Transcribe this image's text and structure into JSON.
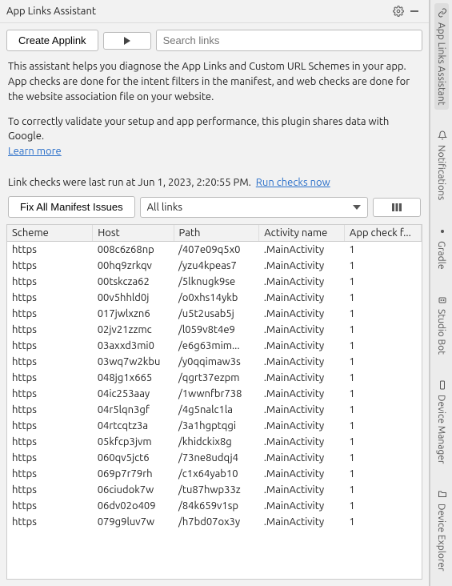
{
  "header": {
    "title": "App Links Assistant"
  },
  "toolbar": {
    "create_label": "Create Applink",
    "search_placeholder": "Search links"
  },
  "description": {
    "p1": "This assistant helps you diagnose the App Links and Custom URL Schemes in your app. App checks are done for the intent filters in the manifest, and web checks are done for the website association file on your website.",
    "p2": "To correctly validate your setup and app performance, this plugin shares data with Google.",
    "learn_more": "Learn more"
  },
  "status": {
    "prefix": "Link checks were last run at Jun 1, 2023, 2:20:55 PM.",
    "run_now": "Run checks now"
  },
  "controls": {
    "fix_label": "Fix All Manifest Issues",
    "filter_label": "All links"
  },
  "columns": {
    "scheme": "Scheme",
    "host": "Host",
    "path": "Path",
    "activity": "Activity name",
    "check": "App check f..."
  },
  "rows": [
    {
      "scheme": "https",
      "host": "008c6z68np",
      "path": "/407e09q5x0",
      "activity": ".MainActivity",
      "check": "1"
    },
    {
      "scheme": "https",
      "host": "00hq9zrkqv",
      "path": "/yzu4kpeas7",
      "activity": ".MainActivity",
      "check": "1"
    },
    {
      "scheme": "https",
      "host": "00tskcza62",
      "path": "/5lknugk9se",
      "activity": ".MainActivity",
      "check": "1"
    },
    {
      "scheme": "https",
      "host": "00v5hhld0j",
      "path": "/o0xhs14ykb",
      "activity": ".MainActivity",
      "check": "1"
    },
    {
      "scheme": "https",
      "host": "017jwlxzn6",
      "path": "/u5t2usab5j",
      "activity": ".MainActivity",
      "check": "1"
    },
    {
      "scheme": "https",
      "host": "02jv21zzmc",
      "path": "/l059v8t4e9",
      "activity": ".MainActivity",
      "check": "1"
    },
    {
      "scheme": "https",
      "host": "03axxd3mi0",
      "path": "/e6g63mim...",
      "activity": ".MainActivity",
      "check": "1"
    },
    {
      "scheme": "https",
      "host": "03wq7w2kbu",
      "path": "/y0qqimaw3s",
      "activity": ".MainActivity",
      "check": "1"
    },
    {
      "scheme": "https",
      "host": "048jg1x665",
      "path": "/qgrt37ezpm",
      "activity": ".MainActivity",
      "check": "1"
    },
    {
      "scheme": "https",
      "host": "04ic253aay",
      "path": "/1wwnfbr738",
      "activity": ".MainActivity",
      "check": "1"
    },
    {
      "scheme": "https",
      "host": "04r5lqn3gf",
      "path": "/4g5nalc1la",
      "activity": ".MainActivity",
      "check": "1"
    },
    {
      "scheme": "https",
      "host": "04rtcqtz3a",
      "path": "/3a1hgptqgi",
      "activity": ".MainActivity",
      "check": "1"
    },
    {
      "scheme": "https",
      "host": "05kfcp3jvm",
      "path": "/khidckix8g",
      "activity": ".MainActivity",
      "check": "1"
    },
    {
      "scheme": "https",
      "host": "060qv5jct6",
      "path": "/73ne8udqj4",
      "activity": ".MainActivity",
      "check": "1"
    },
    {
      "scheme": "https",
      "host": "069p7r79rh",
      "path": "/c1x64yab10",
      "activity": ".MainActivity",
      "check": "1"
    },
    {
      "scheme": "https",
      "host": "06ciudok7w",
      "path": "/tu87hwp33z",
      "activity": ".MainActivity",
      "check": "1"
    },
    {
      "scheme": "https",
      "host": "06dv02o409",
      "path": "/84k659v1sp",
      "activity": ".MainActivity",
      "check": "1"
    },
    {
      "scheme": "https",
      "host": "079g9luv7w",
      "path": "/h7bd07ox3y",
      "activity": ".MainActivity",
      "check": "1"
    }
  ],
  "side_tabs": {
    "app_links": "App Links Assistant",
    "notifications": "Notifications",
    "gradle": "Gradle",
    "studio_bot": "Studio Bot",
    "device_manager": "Device Manager",
    "device_explorer": "Device Explorer"
  }
}
